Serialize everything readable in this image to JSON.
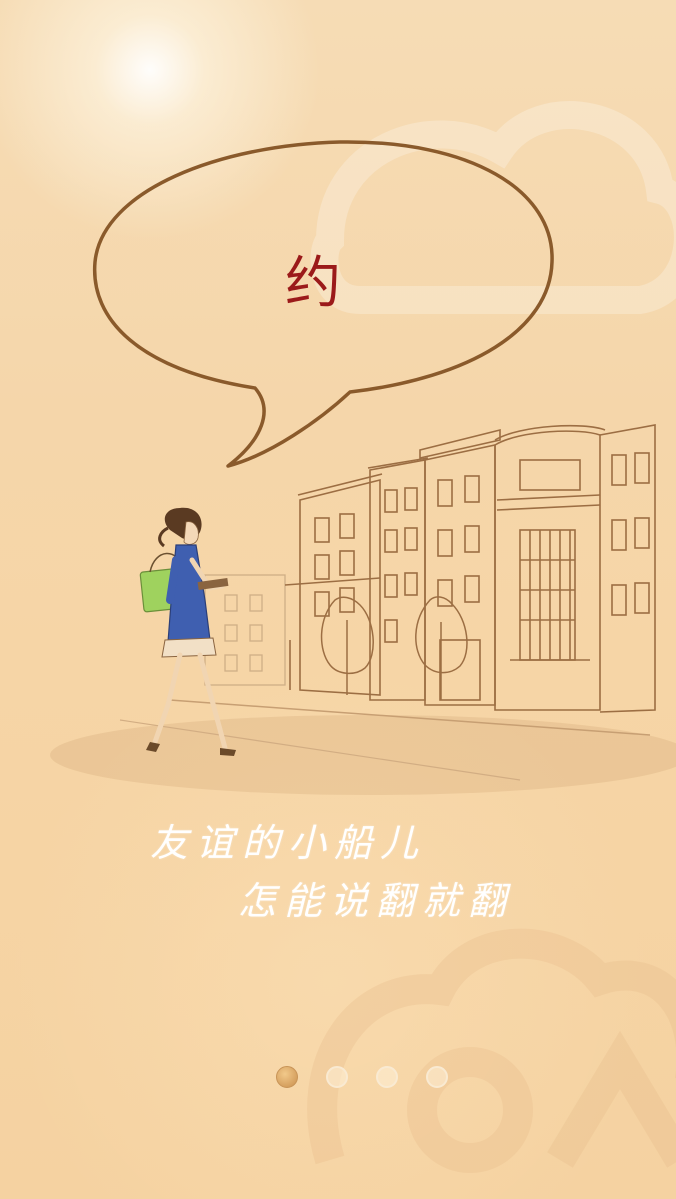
{
  "speech_bubble": {
    "text": "约"
  },
  "caption": {
    "line1": "友谊的小船儿",
    "line2": "怎能说翻就翻"
  },
  "pager": {
    "total_pages": 4,
    "active_index": 0
  },
  "colors": {
    "background": "#f5d6aa",
    "bubble_outline": "#8a5a2b",
    "bubble_text": "#9b1a1a",
    "caption_text": "#ffffff",
    "active_dot": "#d6a160"
  },
  "icons": {
    "illustration": "woman-walking-street-illustration",
    "watermark": "cloud-logo-watermark"
  }
}
